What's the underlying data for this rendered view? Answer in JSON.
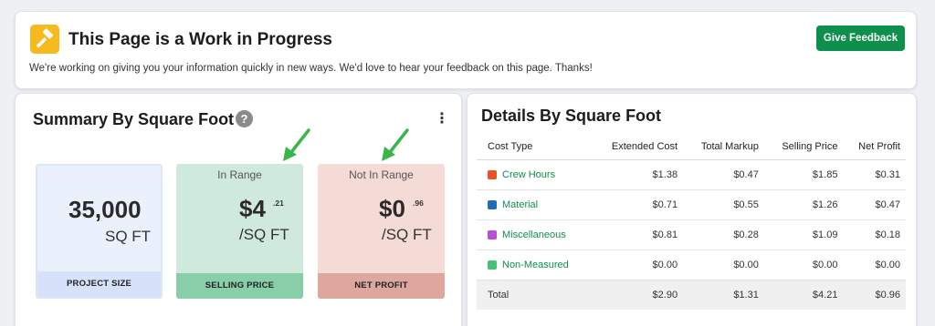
{
  "banner": {
    "icon": "hammer-icon",
    "title": "This Page is a Work in Progress",
    "text": "We're working on giving you your information quickly in new ways. We'd love to hear your feedback on this page. Thanks!",
    "feedback_label": "Give Feedback"
  },
  "summary": {
    "title": "Summary By Square Foot",
    "help": "?",
    "menu": "⋮",
    "tiles": {
      "project_size": {
        "value": "35,000",
        "unit": "SQ FT",
        "footer": "PROJECT SIZE"
      },
      "selling_price": {
        "status": "In Range",
        "value": "$4",
        "cents": ".21",
        "unit": "/SQ FT",
        "footer": "SELLING PRICE"
      },
      "net_profit": {
        "status": "Not In Range",
        "value": "$0",
        "cents": ".96",
        "unit": "/SQ FT",
        "footer": "NET PROFIT"
      }
    }
  },
  "details": {
    "title": "Details By Square Foot",
    "headers": [
      "Cost Type",
      "Extended Cost",
      "Total Markup",
      "Selling Price",
      "Net Profit"
    ],
    "rows": [
      {
        "type": "Crew Hours",
        "color": "#e8542a",
        "extended": "$1.38",
        "markup": "$0.47",
        "selling": "$1.85",
        "profit": "$0.31"
      },
      {
        "type": "Material",
        "color": "#1f6fb5",
        "extended": "$0.71",
        "markup": "$0.55",
        "selling": "$1.26",
        "profit": "$0.47"
      },
      {
        "type": "Miscellaneous",
        "color": "#b84ed1",
        "extended": "$0.81",
        "markup": "$0.28",
        "selling": "$1.09",
        "profit": "$0.18"
      },
      {
        "type": "Non-Measured",
        "color": "#47c07a",
        "extended": "$0.00",
        "markup": "$0.00",
        "selling": "$0.00",
        "profit": "$0.00"
      }
    ],
    "total": {
      "label": "Total",
      "extended": "$2.90",
      "markup": "$1.31",
      "selling": "$4.21",
      "profit": "$0.96"
    }
  },
  "colors": {
    "accent_green": "#0e8f4b",
    "banner_icon": "#f6b91e",
    "arrow_green": "#3bb54a"
  }
}
